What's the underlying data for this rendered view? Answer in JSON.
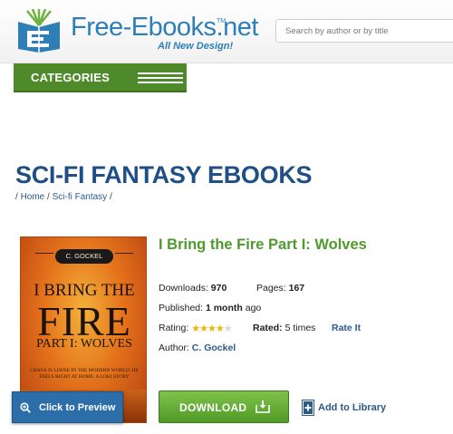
{
  "header": {
    "logo_text": "Free-Ebooks.net",
    "logo_tm": "TM",
    "tagline": "All New Design!",
    "search_placeholder": "Search by author or by title"
  },
  "nav": {
    "categories_label": "CATEGORIES"
  },
  "page": {
    "title": "SCI-FI FANTASY EBOOKS",
    "breadcrumb": {
      "sep1": "/ ",
      "home": "Home",
      "sep2": " / ",
      "category": "Sci-fi Fantasy",
      "sep3": " /"
    }
  },
  "book": {
    "title": "I Bring the Fire Part I: Wolves",
    "downloads_label": "Downloads:",
    "downloads_value": "970",
    "pages_label": "Pages:",
    "pages_value": "167",
    "published_label": "Published:",
    "published_value": "1 month",
    "published_suffix": "ago",
    "rating_label": "Rating:",
    "rating_value": 4,
    "rating_max": 5,
    "rated_label": "Rated:",
    "rated_value": "5 times",
    "rate_it": "Rate It",
    "author_label": "Author:",
    "author_value": "C. Gockel",
    "cover": {
      "author": "C. GOCKEL",
      "line1": "I BRING THE",
      "line2": "FIRE",
      "line3": "PART I: WOLVES",
      "tagline": "CHAOS IS LOOSE IN THE MODERN WORLD. HE FEELS RIGHT AT HOME. A LOKI STORY"
    }
  },
  "actions": {
    "preview": "Click to Preview",
    "download": "DOWNLOAD",
    "add_library": "Add to Library"
  },
  "colors": {
    "brand_blue": "#2e7fb8",
    "title_blue": "#1f4f85",
    "green": "#4e8a2a",
    "star": "#f0b400"
  }
}
